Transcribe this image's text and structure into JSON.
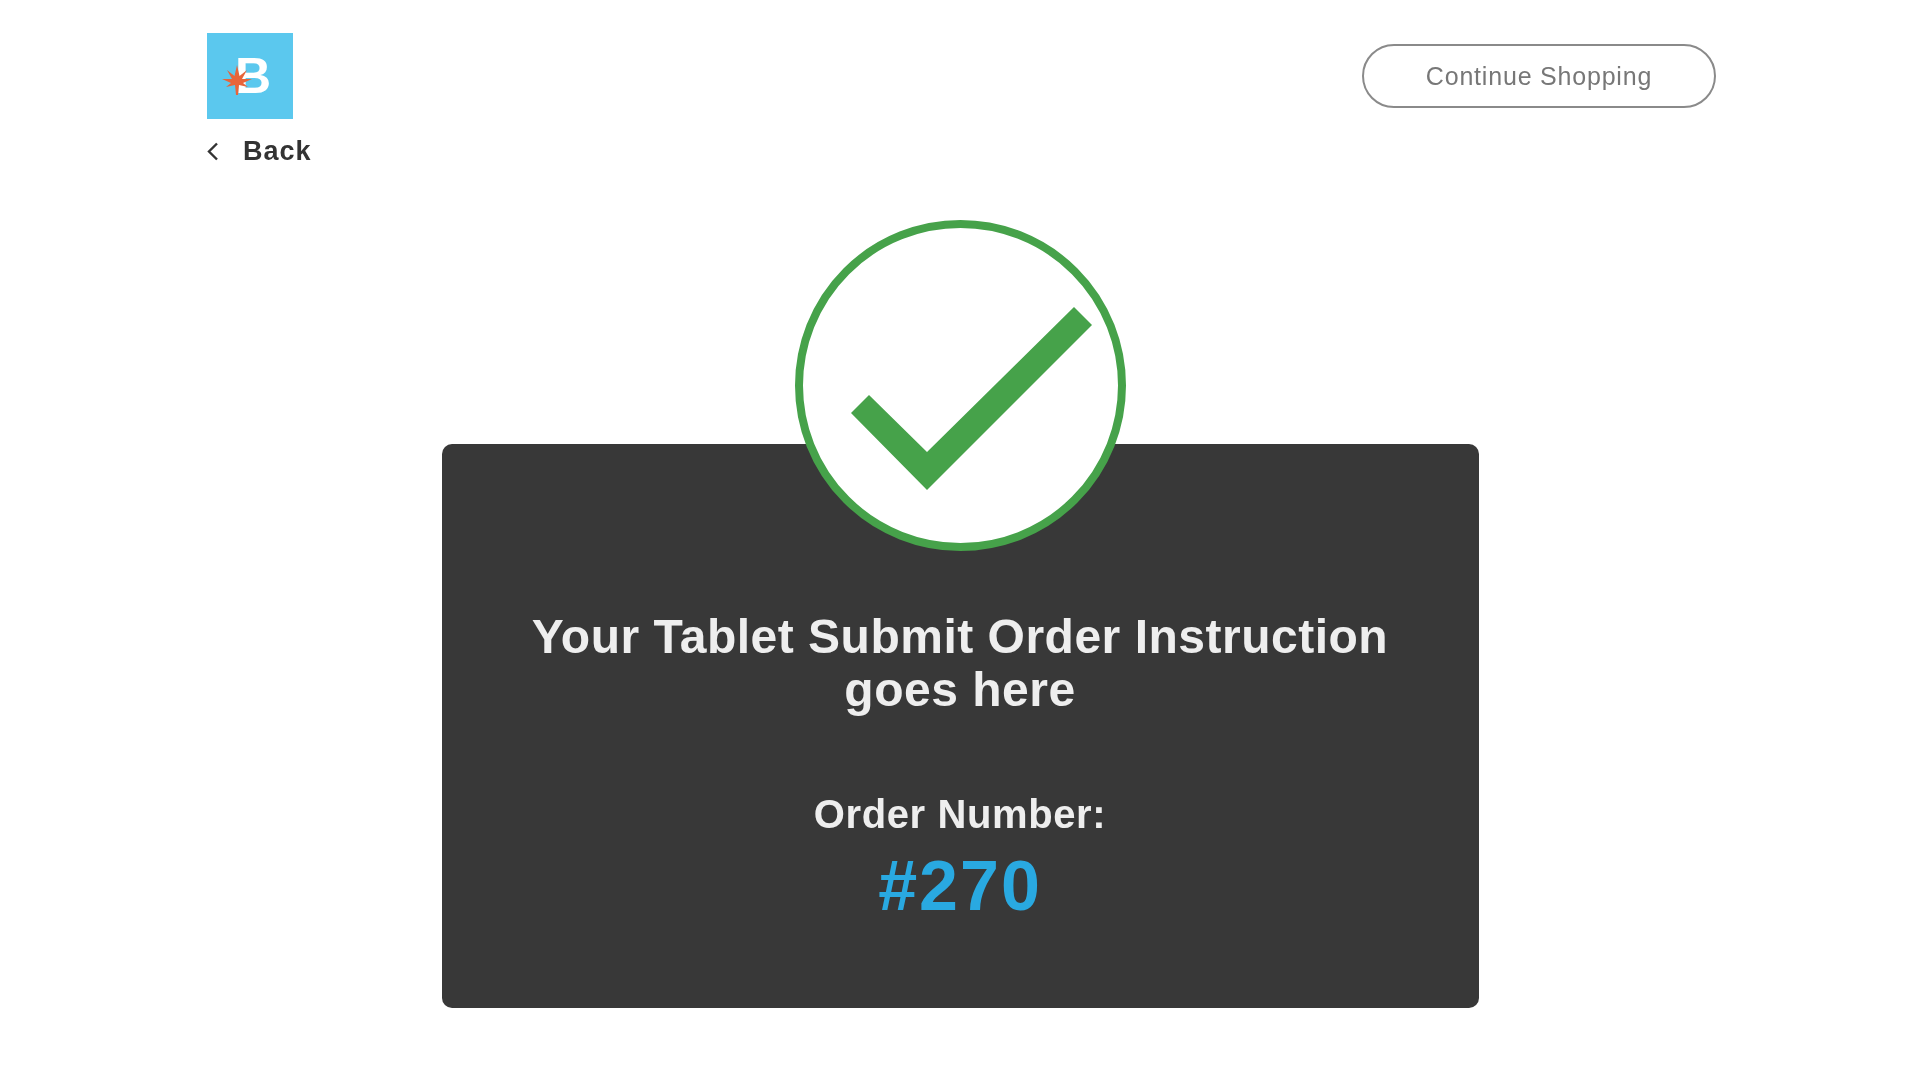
{
  "header": {
    "logo_letter": "B",
    "back_label": "Back",
    "continue_button": "Continue Shopping"
  },
  "confirmation": {
    "message": "Your Tablet Submit Order Instruction goes here",
    "order_label": "Order Number:",
    "order_number": "#270"
  }
}
